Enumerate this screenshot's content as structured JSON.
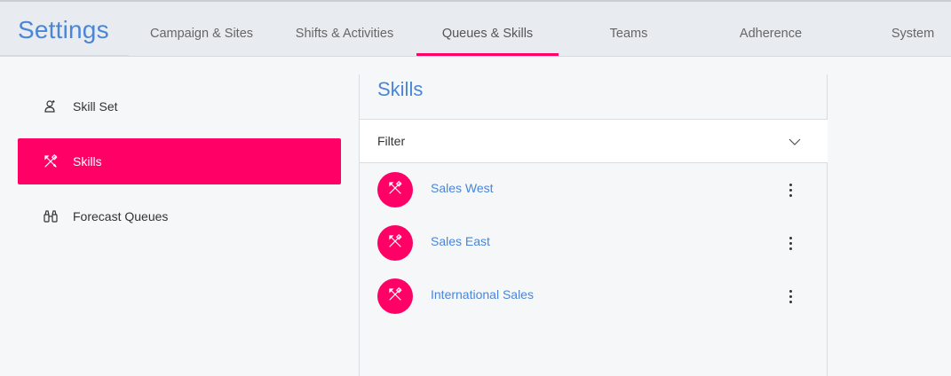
{
  "header": {
    "title": "Settings",
    "tabs": [
      {
        "label": "Campaign & Sites"
      },
      {
        "label": "Shifts & Activities"
      },
      {
        "label": "Queues & Skills",
        "active": true
      },
      {
        "label": "Teams"
      },
      {
        "label": "Adherence"
      },
      {
        "label": "System"
      }
    ]
  },
  "sidebar": {
    "items": [
      {
        "label": "Skill Set",
        "icon": "skill-set-icon"
      },
      {
        "label": "Skills",
        "icon": "skills-icon",
        "active": true
      },
      {
        "label": "Forecast Queues",
        "icon": "binoculars-icon"
      }
    ]
  },
  "main": {
    "title": "Skills",
    "filter": {
      "label": "Filter"
    },
    "skills": [
      {
        "name": "Sales West"
      },
      {
        "name": "Sales East"
      },
      {
        "name": "International Sales"
      }
    ]
  },
  "colors": {
    "accent": "#ff0066",
    "title_blue": "#4a86d8"
  }
}
